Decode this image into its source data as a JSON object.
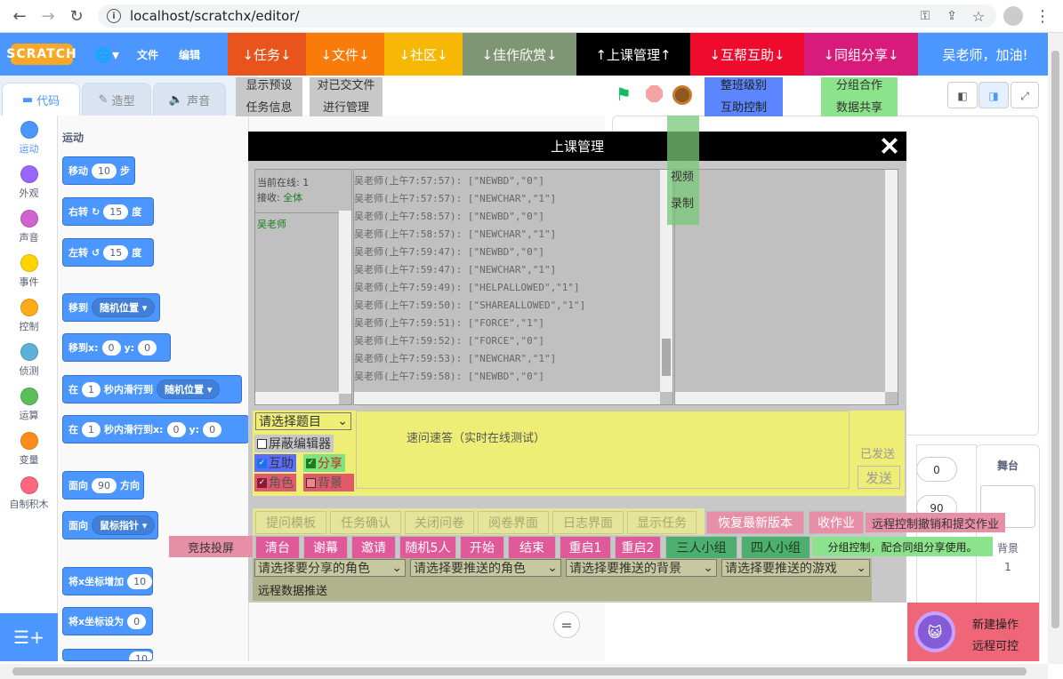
{
  "browser": {
    "url": "localhost/scratchx/editor/"
  },
  "menubar": {
    "logo": "SCRATCH",
    "file": "文件",
    "edit": "编辑",
    "tabs": [
      {
        "label": "↓任务↓",
        "color": "#e8541b"
      },
      {
        "label": "↓文件↓",
        "color": "#f97c0b"
      },
      {
        "label": "↓社区↓",
        "color": "#f7b705"
      },
      {
        "label": "↓佳作欣赏↓",
        "color": "#7f9675"
      },
      {
        "label": "↑上课管理↑",
        "color": "#000000"
      },
      {
        "label": "↓互帮互助↓",
        "color": "#ef0b2e"
      },
      {
        "label": "↓同组分享↓",
        "color": "#d81b7a"
      }
    ],
    "greeting": "吴老师，加油!"
  },
  "subbuttons": {
    "preset_line1": "显示预设",
    "preset_line2": "任务信息",
    "files_line1": "对已交文件",
    "files_line2": "进行管理",
    "class_line1": "整班级别",
    "class_line2": "互助控制",
    "group_line1": "分组合作",
    "group_line2": "数据共享",
    "video_line1": "视频",
    "video_line2": "录制"
  },
  "editor_tabs": [
    "代码",
    "造型",
    "声音"
  ],
  "categories": [
    {
      "label": "运动",
      "color": "#4c97ff"
    },
    {
      "label": "外观",
      "color": "#9966ff"
    },
    {
      "label": "声音",
      "color": "#cf63cf"
    },
    {
      "label": "事件",
      "color": "#ffd500"
    },
    {
      "label": "控制",
      "color": "#ffab19"
    },
    {
      "label": "侦测",
      "color": "#5cb1d6"
    },
    {
      "label": "运算",
      "color": "#59c059"
    },
    {
      "label": "变量",
      "color": "#ff8c1a"
    },
    {
      "label": "自制积木",
      "color": "#ff6680"
    }
  ],
  "palette": {
    "heading": "运动",
    "move": "移动",
    "move_val": "10",
    "steps": "步",
    "turn_right": "右转",
    "turn_val1": "15",
    "deg": "度",
    "turn_left": "左转",
    "turn_val2": "15",
    "goto": "移到",
    "goto_dd": "随机位置",
    "gotoxy": "移到x:",
    "gx": "0",
    "y": "y:",
    "gy": "0",
    "glide": "在",
    "glide_val": "1",
    "glide_mid": "秒内滑行到",
    "glide_dd": "随机位置",
    "glide2_mid": "秒内滑行到x:",
    "g2x": "0",
    "g2y": "0",
    "point": "面向",
    "point_val": "90",
    "dir": "方向",
    "point_towards": "面向",
    "towards_dd": "鼠标指针",
    "changex": "将x坐标增加",
    "changex_val": "10",
    "setx": "将x坐标设为",
    "setx_val": "0",
    "changey_val": "10"
  },
  "dialog": {
    "title": "上课管理",
    "online_label": "当前在线: 1",
    "recv_label": "接收:",
    "recv_value": "全体",
    "user": "吴老师",
    "log": [
      "吴老师(上午7:57:57): [\"NEWBD\",\"0\"]",
      "吴老师(上午7:57:57): [\"NEWCHAR\",\"1\"]",
      "吴老师(上午7:58:57): [\"NEWBD\",\"0\"]",
      "吴老师(上午7:58:57): [\"NEWCHAR\",\"1\"]",
      "吴老师(上午7:59:47): [\"NEWBD\",\"0\"]",
      "吴老师(上午7:59:47): [\"NEWCHAR\",\"1\"]",
      "吴老师(上午7:59:49): [\"HELPALLOWED\",\"1\"]",
      "吴老师(上午7:59:50): [\"SHAREALLOWED\",\"1\"]",
      "吴老师(上午7:59:51): [\"FORCE\",\"1\"]",
      "吴老师(上午7:59:52): [\"FORCE\",\"0\"]",
      "吴老师(上午7:59:53): [\"NEWCHAR\",\"1\"]",
      "吴老师(上午7:59:58): [\"NEWBD\",\"0\"]"
    ],
    "question_select": "请选择题目",
    "quiz_placeholder": "速问速答（实时在线测试）",
    "sent_label": "已发送",
    "send_button": "发送",
    "block_editor": "屏蔽编辑器",
    "help": "互助",
    "share": "分享",
    "role": "角色",
    "background": "背景",
    "row1": [
      "提问模板",
      "任务确认",
      "关闭问卷",
      "阅卷界面",
      "日志界面",
      "显示任务"
    ],
    "restore": "恢复最新版本",
    "collect": "收作业",
    "remote_note": "远程控制撤销和提交作业",
    "competition": "竞技投屏",
    "row2": [
      "清台",
      "谢幕",
      "邀请",
      "随机5人",
      "开始",
      "结束",
      "重启1",
      "重启2"
    ],
    "group3": "三人小组",
    "group4": "四人小组",
    "group_note": "分组控制，配合同组分享使用。",
    "sel_role": "请选择要分享的角色",
    "sel_push_role": "请选择要推送的角色",
    "sel_push_bg": "请选择要推送的背景",
    "sel_push_game": "请选择要推送的游戏",
    "remote_push": "远程数据推送"
  },
  "stage_panel": {
    "stage_label": "舞台",
    "backdrop_label": "背景",
    "backdrop_count": "1",
    "val0": "0",
    "val90": "90",
    "new_op1": "新建操作",
    "new_op2": "远程可控",
    "zoom_eq": "="
  }
}
